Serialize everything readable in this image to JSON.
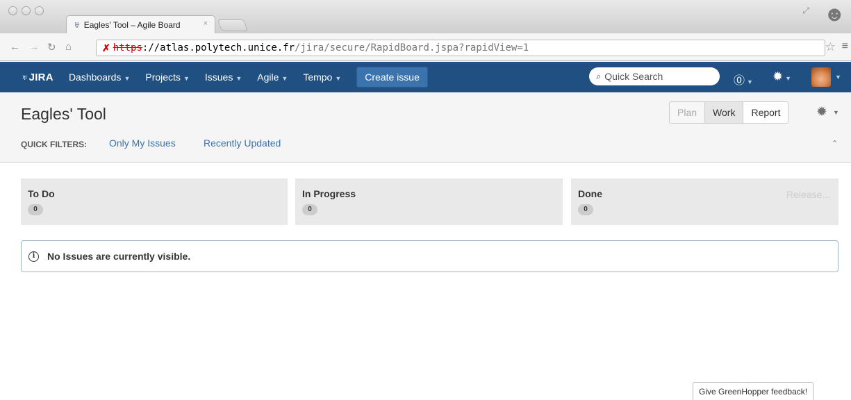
{
  "browser": {
    "tab_title": "Eagles' Tool – Agile Board",
    "tab_close": "×",
    "url_scheme": "https",
    "url_host": "://atlas.polytech.unice.fr",
    "url_path": "/jira/secure/RapidBoard.jspa?rapidView=1",
    "lock_icon": "✗"
  },
  "header": {
    "logo": "JIRA",
    "nav": [
      {
        "label": "Dashboards"
      },
      {
        "label": "Projects"
      },
      {
        "label": "Issues"
      },
      {
        "label": "Agile"
      },
      {
        "label": "Tempo"
      }
    ],
    "create_label": "Create issue",
    "search_placeholder": "Quick Search"
  },
  "board": {
    "title": "Eagles' Tool",
    "modes": {
      "plan": "Plan",
      "work": "Work",
      "report": "Report"
    },
    "quick_filters_label": "QUICK FILTERS:",
    "quick_filters": [
      "Only My Issues",
      "Recently Updated"
    ]
  },
  "columns": [
    {
      "name": "To Do",
      "count": "0"
    },
    {
      "name": "In Progress",
      "count": "0"
    },
    {
      "name": "Done",
      "count": "0",
      "release": "Release..."
    }
  ],
  "message": "No Issues are currently visible.",
  "feedback": "Give GreenHopper feedback!",
  "colors": {
    "header": "#205081",
    "create": "#3b73af",
    "link": "#3b73af"
  }
}
